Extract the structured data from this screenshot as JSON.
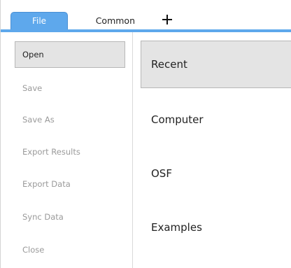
{
  "tabs": {
    "file_label": "File",
    "common_label": "Common",
    "add_icon": "plus-icon"
  },
  "colors": {
    "accent": "#5ea8ec",
    "selected_bg": "#e4e4e4",
    "disabled_text": "#9a9a9a"
  },
  "menu": {
    "items": [
      {
        "label": "Open",
        "selected": true,
        "enabled": true
      },
      {
        "label": "Save",
        "selected": false,
        "enabled": false
      },
      {
        "label": "Save As",
        "selected": false,
        "enabled": false
      },
      {
        "label": "Export Results",
        "selected": false,
        "enabled": false
      },
      {
        "label": "Export Data",
        "selected": false,
        "enabled": false
      },
      {
        "label": "Sync Data",
        "selected": false,
        "enabled": false
      },
      {
        "label": "Close",
        "selected": false,
        "enabled": false
      }
    ]
  },
  "submenu": {
    "items": [
      {
        "label": "Recent",
        "selected": true
      },
      {
        "label": "Computer",
        "selected": false
      },
      {
        "label": "OSF",
        "selected": false
      },
      {
        "label": "Examples",
        "selected": false
      }
    ]
  }
}
